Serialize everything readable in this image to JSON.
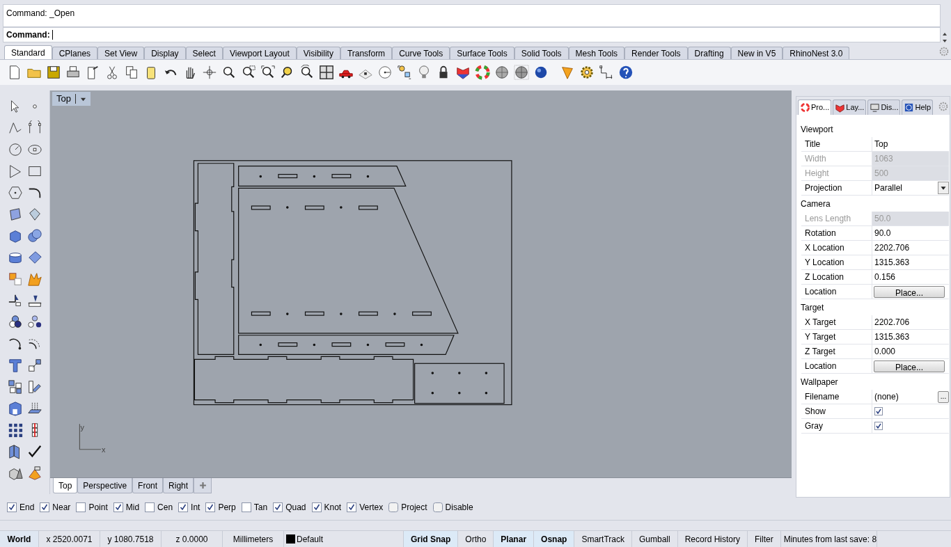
{
  "command_history": [
    "Command: _Open"
  ],
  "command_prompt": "Command:",
  "toolbar_tabs": [
    {
      "label": "Standard",
      "selected": true
    },
    {
      "label": "CPlanes",
      "selected": false
    },
    {
      "label": "Set View",
      "selected": false
    },
    {
      "label": "Display",
      "selected": false
    },
    {
      "label": "Select",
      "selected": false
    },
    {
      "label": "Viewport Layout",
      "selected": false
    },
    {
      "label": "Visibility",
      "selected": false
    },
    {
      "label": "Transform",
      "selected": false
    },
    {
      "label": "Curve Tools",
      "selected": false
    },
    {
      "label": "Surface Tools",
      "selected": false
    },
    {
      "label": "Solid Tools",
      "selected": false
    },
    {
      "label": "Mesh Tools",
      "selected": false
    },
    {
      "label": "Render Tools",
      "selected": false
    },
    {
      "label": "Drafting",
      "selected": false
    },
    {
      "label": "New in V5",
      "selected": false
    },
    {
      "label": "RhinoNest 3.0",
      "selected": false
    }
  ],
  "viewport": {
    "title": "Top",
    "axis_y": "y",
    "axis_x": "x"
  },
  "viewport_tabs": [
    {
      "label": "Top",
      "selected": true
    },
    {
      "label": "Perspective",
      "selected": false
    },
    {
      "label": "Front",
      "selected": false
    },
    {
      "label": "Right",
      "selected": false
    }
  ],
  "panel_tabs": [
    {
      "label": "Pro...",
      "selected": true
    },
    {
      "label": "Lay...",
      "selected": false
    },
    {
      "label": "Dis...",
      "selected": false
    },
    {
      "label": "Help",
      "selected": false
    }
  ],
  "properties": [
    {
      "kind": "section",
      "label": "Viewport"
    },
    {
      "kind": "text",
      "label": "Title",
      "value": "Top",
      "disabled": false
    },
    {
      "kind": "text",
      "label": "Width",
      "value": "1063",
      "disabled": true
    },
    {
      "kind": "text",
      "label": "Height",
      "value": "500",
      "disabled": true
    },
    {
      "kind": "dropdown",
      "label": "Projection",
      "value": "Parallel",
      "disabled": false
    },
    {
      "kind": "section",
      "label": "Camera"
    },
    {
      "kind": "text",
      "label": "Lens Length",
      "value": "50.0",
      "disabled": true
    },
    {
      "kind": "text",
      "label": "Rotation",
      "value": "90.0",
      "disabled": false
    },
    {
      "kind": "text",
      "label": "X Location",
      "value": "2202.706",
      "disabled": false
    },
    {
      "kind": "text",
      "label": "Y Location",
      "value": "1315.363",
      "disabled": false
    },
    {
      "kind": "text",
      "label": "Z Location",
      "value": "0.156",
      "disabled": false
    },
    {
      "kind": "button",
      "label": "Location",
      "value": "Place...",
      "disabled": false
    },
    {
      "kind": "section",
      "label": "Target"
    },
    {
      "kind": "text",
      "label": "X Target",
      "value": "2202.706",
      "disabled": false
    },
    {
      "kind": "text",
      "label": "Y Target",
      "value": "1315.363",
      "disabled": false
    },
    {
      "kind": "text",
      "label": "Z Target",
      "value": "0.000",
      "disabled": false
    },
    {
      "kind": "button",
      "label": "Location",
      "value": "Place...",
      "disabled": false
    },
    {
      "kind": "section",
      "label": "Wallpaper"
    },
    {
      "kind": "file",
      "label": "Filename",
      "value": "(none)",
      "button": "...",
      "disabled": false
    },
    {
      "kind": "checkbox",
      "label": "Show",
      "checked": true,
      "disabled": false
    },
    {
      "kind": "checkbox",
      "label": "Gray",
      "checked": true,
      "disabled": false
    }
  ],
  "osnaps": [
    {
      "kind": "check",
      "label": "End",
      "checked": true
    },
    {
      "kind": "check",
      "label": "Near",
      "checked": true
    },
    {
      "kind": "check",
      "label": "Point",
      "checked": false
    },
    {
      "kind": "check",
      "label": "Mid",
      "checked": true
    },
    {
      "kind": "check",
      "label": "Cen",
      "checked": false
    },
    {
      "kind": "check",
      "label": "Int",
      "checked": true
    },
    {
      "kind": "check",
      "label": "Perp",
      "checked": true
    },
    {
      "kind": "check",
      "label": "Tan",
      "checked": false
    },
    {
      "kind": "check",
      "label": "Quad",
      "checked": true
    },
    {
      "kind": "check",
      "label": "Knot",
      "checked": true
    },
    {
      "kind": "check",
      "label": "Vertex",
      "checked": true
    },
    {
      "kind": "toggle",
      "label": "Project",
      "checked": false
    },
    {
      "kind": "toggle",
      "label": "Disable",
      "checked": false
    }
  ],
  "status_bar": [
    {
      "kind": "cplane",
      "label": "World"
    },
    {
      "kind": "coord",
      "label": "x 2520.0071"
    },
    {
      "kind": "coord",
      "label": "y 1080.7518"
    },
    {
      "kind": "coord",
      "label": "z 0.0000"
    },
    {
      "kind": "units",
      "label": "Millimeters"
    },
    {
      "kind": "layer",
      "label": "Default"
    },
    {
      "kind": "toggle",
      "label": "Grid Snap",
      "on": true
    },
    {
      "kind": "toggle",
      "label": "Ortho",
      "on": false
    },
    {
      "kind": "toggle",
      "label": "Planar",
      "on": true
    },
    {
      "kind": "toggle",
      "label": "Osnap",
      "on": true
    },
    {
      "kind": "toggle",
      "label": "SmartTrack",
      "on": false
    },
    {
      "kind": "toggle",
      "label": "Gumball",
      "on": false
    },
    {
      "kind": "toggle",
      "label": "Record History",
      "on": false
    },
    {
      "kind": "toggle",
      "label": "Filter",
      "on": false
    },
    {
      "kind": "info",
      "label": "Minutes from last save: 8"
    }
  ]
}
